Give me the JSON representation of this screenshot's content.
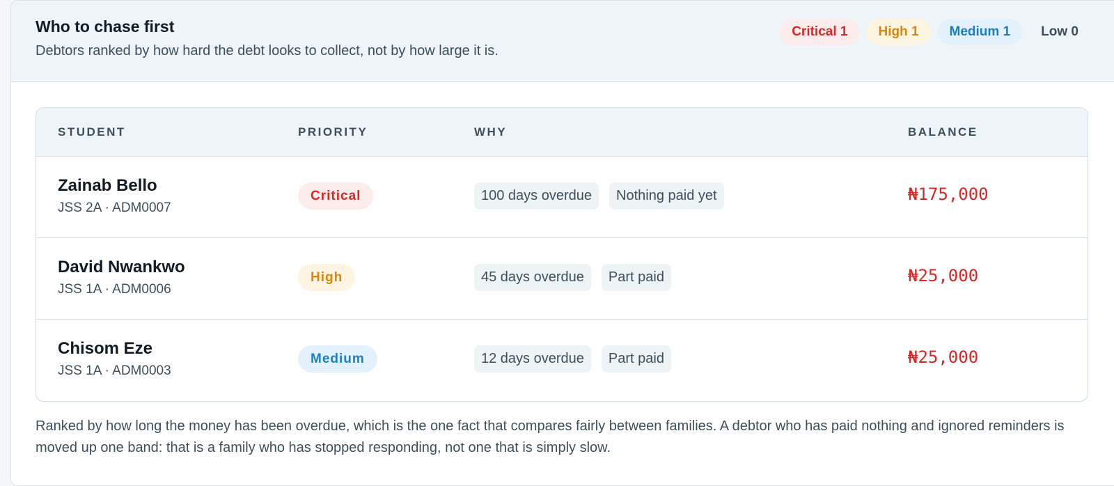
{
  "header": {
    "title": "Who to chase first",
    "subtitle": "Debtors ranked by how hard the debt looks to collect, not by how large it is."
  },
  "summary": {
    "critical": "Critical 1",
    "high": "High 1",
    "medium": "Medium 1",
    "low": "Low 0"
  },
  "table": {
    "columns": {
      "student": "STUDENT",
      "priority": "PRIORITY",
      "why": "WHY",
      "balance": "BALANCE"
    },
    "rows": [
      {
        "name": "Zainab Bello",
        "meta": "JSS 2A · ADM0007",
        "priority": "Critical",
        "reasons": [
          "100 days overdue",
          "Nothing paid yet"
        ],
        "balance": "₦175,000"
      },
      {
        "name": "David Nwankwo",
        "meta": "JSS 1A · ADM0006",
        "priority": "High",
        "reasons": [
          "45 days overdue",
          "Part paid"
        ],
        "balance": "₦25,000"
      },
      {
        "name": "Chisom Eze",
        "meta": "JSS 1A · ADM0003",
        "priority": "Medium",
        "reasons": [
          "12 days overdue",
          "Part paid"
        ],
        "balance": "₦25,000"
      }
    ]
  },
  "footnote": "Ranked by how long the money has been overdue, which is the one fact that compares fairly between families. A debtor who has paid nothing and ignored reminders is moved up one band: that is a family who has stopped responding, not one that is simply slow.",
  "colors": {
    "critical_text": "#d62828",
    "critical_bg": "#fdecec",
    "high_text": "#d8870e",
    "high_bg": "#fdf5e1",
    "medium_text": "#1e7fbd",
    "medium_bg": "#e2f1fb",
    "balance": "#d62828"
  }
}
